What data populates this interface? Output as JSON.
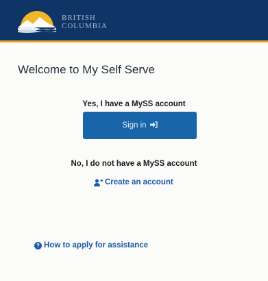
{
  "header": {
    "logo_text_line1": "BRITISH",
    "logo_text_line2": "COLUMBIA",
    "logo_icon": "bc-sun-mountains-logo-icon"
  },
  "main": {
    "title": "Welcome to My Self Serve",
    "existing_account_prompt": "Yes, I have a MySS account",
    "signin_label": "Sign in",
    "signin_icon": "sign-in-arrow-icon",
    "no_account_prompt": "No, I do not have a MySS account",
    "create_account_label": "Create an account",
    "create_account_icon": "add-user-icon",
    "help_link_label": "How to apply for assistance",
    "help_icon": "question-circle-icon"
  },
  "colors": {
    "header_bg": "#0f3566",
    "header_accent": "#e3a82b",
    "primary_button": "#1865a9",
    "link": "#1a5aa6"
  }
}
